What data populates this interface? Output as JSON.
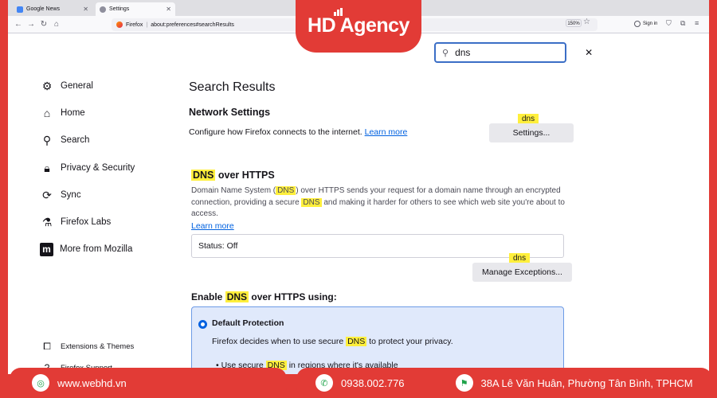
{
  "browser": {
    "tabs": [
      {
        "title": "Google News",
        "icon": "news-icon"
      },
      {
        "title": "Settings",
        "icon": "gear-icon"
      }
    ],
    "url_brand": "Firefox",
    "url": "about:preferences#searchResults",
    "zoom": "150%",
    "sign_in": "Sign in"
  },
  "find": {
    "query": "dns"
  },
  "sidebar": {
    "items": [
      {
        "label": "General",
        "icon": "gear-icon"
      },
      {
        "label": "Home",
        "icon": "home-icon"
      },
      {
        "label": "Search",
        "icon": "search-icon"
      },
      {
        "label": "Privacy & Security",
        "icon": "lock-icon"
      },
      {
        "label": "Sync",
        "icon": "sync-icon"
      },
      {
        "label": "Firefox Labs",
        "icon": "flask-icon"
      },
      {
        "label": "More from Mozilla",
        "icon": "mozilla-icon"
      }
    ],
    "bottom": [
      {
        "label": "Extensions & Themes",
        "icon": "puzzle-icon"
      },
      {
        "label": "Firefox Support",
        "icon": "help-icon"
      }
    ]
  },
  "main": {
    "title": "Search Results",
    "network": {
      "heading": "Network Settings",
      "description": "Configure how Firefox connects to the internet.",
      "learn_more": "Learn more",
      "badge": "dns",
      "button": "Settings..."
    },
    "doh": {
      "title_hl": "DNS",
      "title_rest": " over HTTPS",
      "desc_1": "Domain Name System (",
      "desc_hl1": "DNS",
      "desc_2": ") over HTTPS sends your request for a domain name through an encrypted connection, providing a secure ",
      "desc_hl2": "DNS",
      "desc_3": " and making it harder for others to see which web site you're about to access.",
      "learn_more": "Learn more",
      "status": "Status: Off",
      "badge": "dns",
      "exceptions_button": "Manage Exceptions..."
    },
    "enable": {
      "pre": "Enable ",
      "hl": "DNS",
      "post": " over HTTPS using:"
    },
    "option": {
      "title": "Default Protection",
      "desc_pre": "Firefox decides when to use secure ",
      "desc_hl": "DNS",
      "desc_post": " to protect your privacy.",
      "bullet_pre": "Use secure ",
      "bullet_hl": "DNS",
      "bullet_post": " in regions where it's available"
    }
  },
  "overlay": {
    "logo": "HD Agency",
    "website": "www.webhd.vn",
    "phone": "0938.002.776",
    "address": "38A Lê Văn Huân, Phường Tân Bình, TPHCM"
  },
  "colors": {
    "brand_red": "#e23b36",
    "link_blue": "#0061e0",
    "highlight": "#ffef3c"
  }
}
